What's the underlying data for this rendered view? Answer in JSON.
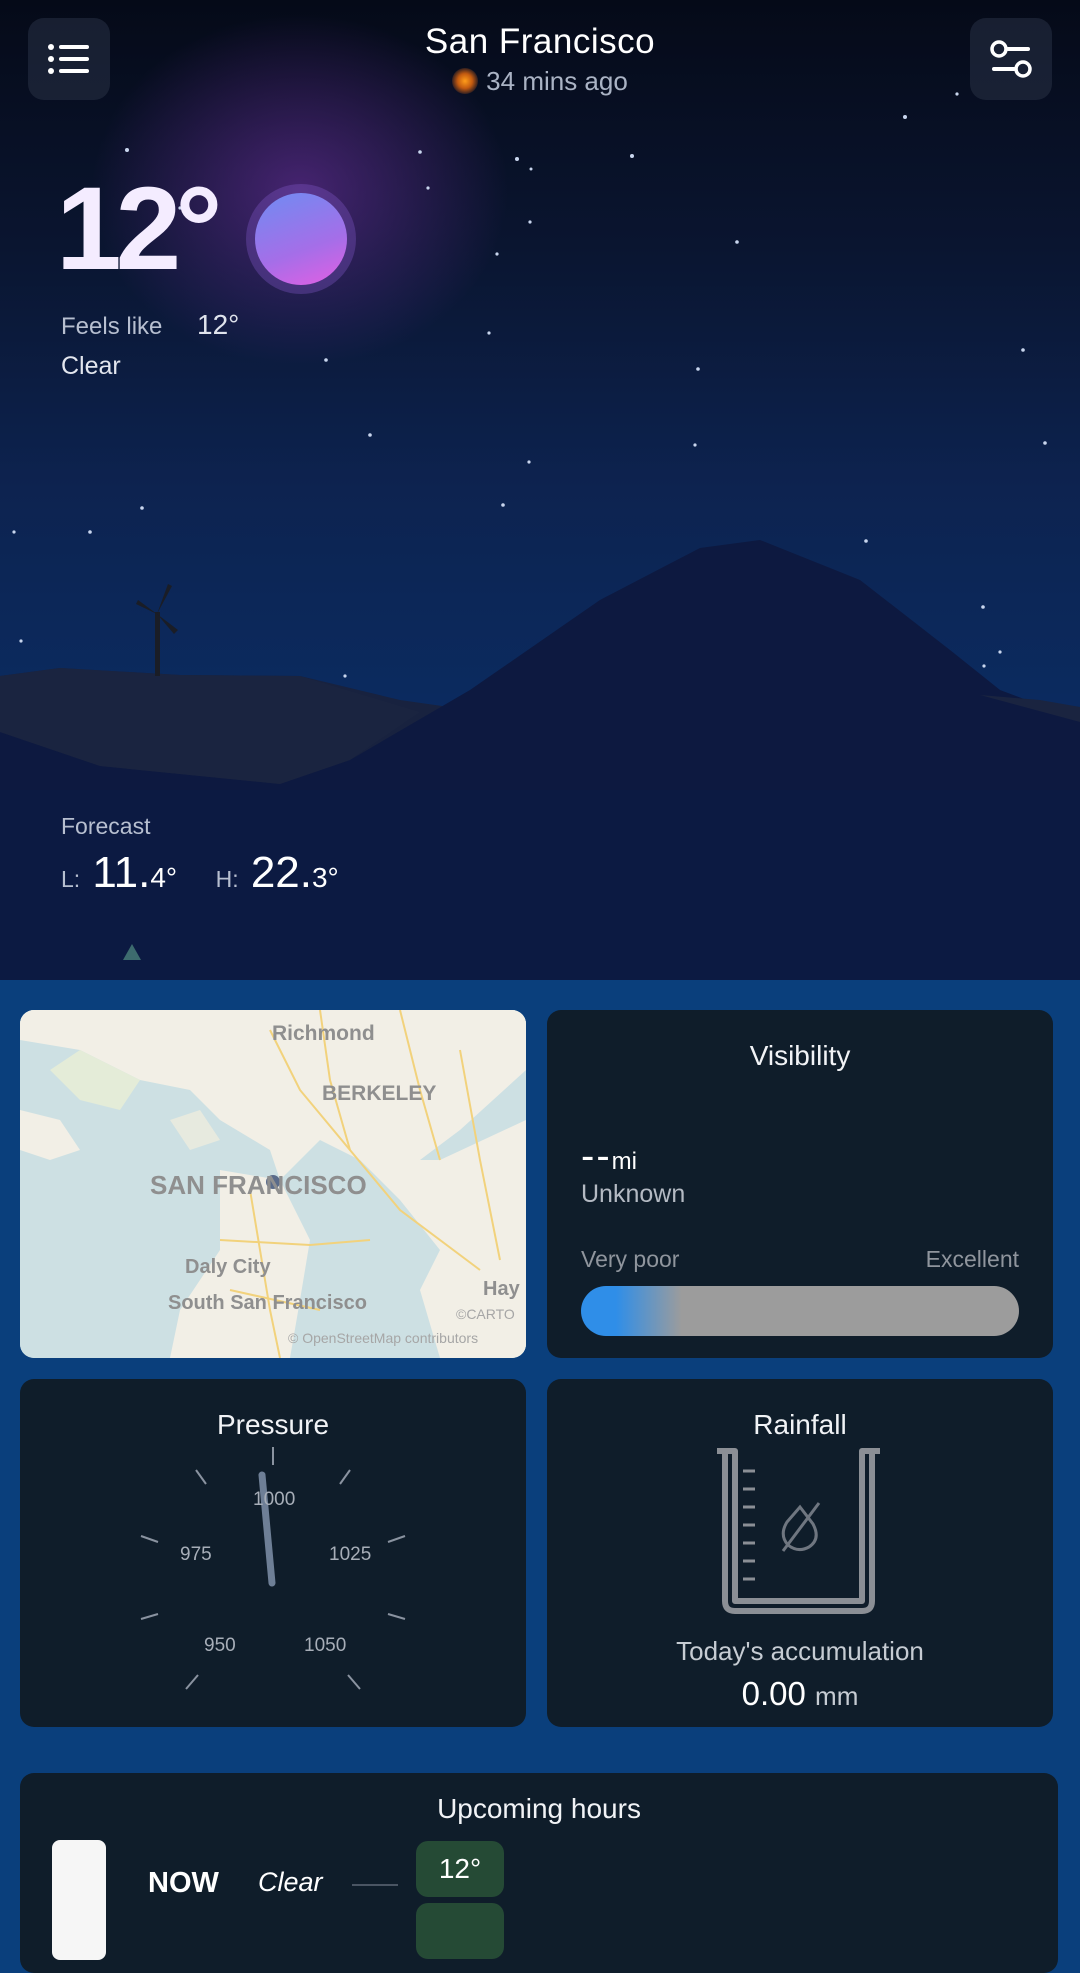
{
  "header": {
    "city": "San Francisco",
    "updated": "34 mins ago",
    "menu_icon": "list-menu-icon",
    "settings_icon": "sliders-settings-icon"
  },
  "current": {
    "temperature": "12°",
    "feels_like_label": "Feels like",
    "feels_like_value": "12°",
    "condition": "Clear"
  },
  "forecast": {
    "label": "Forecast",
    "low_label": "L:",
    "low_int": "11.",
    "low_dec": "4°",
    "high_label": "H:",
    "high_int": "22.",
    "high_dec": "3°"
  },
  "map": {
    "labels": {
      "richmond": "Richmond",
      "berkeley": "BERKELEY",
      "sf": "SAN FRANCISCO",
      "daly": "Daly City",
      "ssf": "South San Francisco",
      "hay": "Hay",
      "carto": "©CARTO",
      "osm": "© OpenStreetMap contributors"
    }
  },
  "visibility": {
    "title": "Visibility",
    "value": "--",
    "unit": "mi",
    "status": "Unknown",
    "scale_min": "Very poor",
    "scale_max": "Excellent",
    "level": 0.18
  },
  "pressure": {
    "title": "Pressure",
    "ticks": [
      "1000",
      "975",
      "1025",
      "950",
      "1050"
    ]
  },
  "rainfall": {
    "title": "Rainfall",
    "caption": "Today's accumulation",
    "value": "0.00",
    "unit": "mm"
  },
  "hours": {
    "title": "Upcoming hours",
    "rows": [
      {
        "time": "NOW",
        "condition": "Clear",
        "temp": "12°"
      }
    ]
  },
  "colors": {
    "accent_blue": "#2f8ee8",
    "temp_badge": "#254a35",
    "card_bg": "#0f1d2a",
    "page_bg": "#0a3f7c"
  }
}
